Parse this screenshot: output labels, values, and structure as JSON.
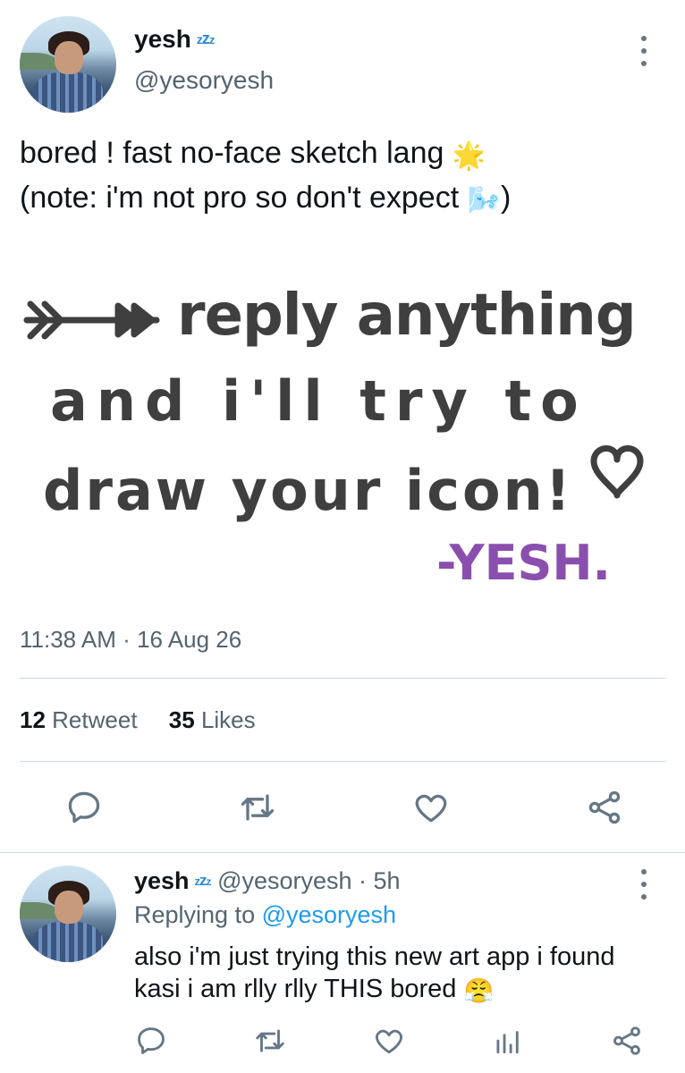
{
  "tweet": {
    "author": {
      "display_name": "yesh",
      "name_badge": "zzz",
      "handle": "@yesoryesh"
    },
    "text_line_1": "bored ! fast no-face sketch lang",
    "text_line_1_emoji": "🌟",
    "text_line_2": "(note: i'm not pro so don't expect",
    "text_line_2_emoji": "🌬️",
    "text_line_2_end": ")",
    "image": {
      "line_1": "reply anything",
      "line_2": "and i'll try to",
      "line_3": "draw your icon!",
      "signature": "-YESH.",
      "text_color": "#3f3f3f",
      "signature_color": "#8a4fae"
    },
    "time": "11:38 AM",
    "date_separator": "·",
    "date": "16 Aug 26",
    "retweet_count": "12",
    "retweet_label": "Retweet",
    "likes_count": "35",
    "likes_label": "Likes",
    "actions": [
      "reply-icon",
      "retweet-icon",
      "heart-icon",
      "share-icon"
    ]
  },
  "reply": {
    "display_name": "yesh",
    "name_badge": "zzz",
    "handle_time": "@yesoryesh · 5h",
    "replying_prefix": "Replying to",
    "replying_to": "@yesoryesh",
    "text": "also i'm just trying this new art app i found kasi i am rlly rlly THIS bored",
    "emoji": "😤",
    "actions": [
      "reply-icon",
      "retweet-icon",
      "heart-icon",
      "analytics-icon",
      "share-icon"
    ]
  },
  "colors": {
    "text_primary": "#0f1419",
    "text_secondary": "#536471",
    "accent": "#1d9bf0",
    "icon": "#657786",
    "divider": "#cfd9de"
  }
}
